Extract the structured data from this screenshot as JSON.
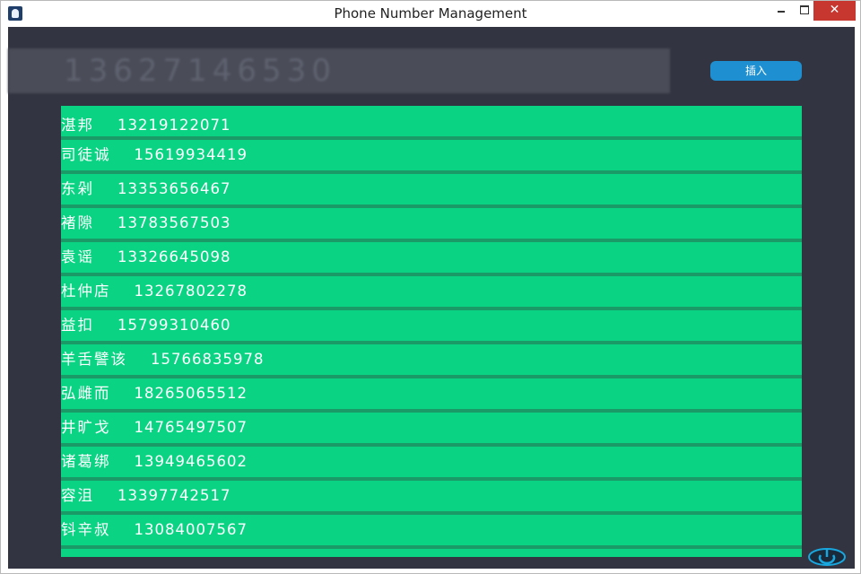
{
  "window": {
    "title": "Phone Number Management",
    "minimize_symbol": "",
    "maximize_symbol": "",
    "close_symbol": "✕"
  },
  "phone_input": {
    "value": "13627146530"
  },
  "insert_button": {
    "label": "插入"
  },
  "contacts": [
    {
      "name": "湛邦",
      "phone": "13219122071"
    },
    {
      "name": "司徒诚",
      "phone": "15619934419"
    },
    {
      "name": "东剁",
      "phone": "13353656467"
    },
    {
      "name": "褚隙",
      "phone": "13783567503"
    },
    {
      "name": "袁谣",
      "phone": "13326645098"
    },
    {
      "name": "杜仲店",
      "phone": "13267802278"
    },
    {
      "name": "益扣",
      "phone": "15799310460"
    },
    {
      "name": "羊舌譬该",
      "phone": "15766835978"
    },
    {
      "name": "弘雌而",
      "phone": "18265065512"
    },
    {
      "name": "井旷戈",
      "phone": "14765497507"
    },
    {
      "name": "诸葛绑",
      "phone": "13949465602"
    },
    {
      "name": "容沮",
      "phone": "13397742517"
    },
    {
      "name": "钭辛叔",
      "phone": "13084007567"
    }
  ],
  "colors": {
    "background": "#323541",
    "list_item": "#0ad483",
    "list_divider": "#1a9a66",
    "insert_button": "#1e8fd0",
    "input_background": "#4a4c58",
    "close_button": "#c7372f"
  },
  "icons": {
    "app": "app-icon",
    "power": "power-icon"
  }
}
